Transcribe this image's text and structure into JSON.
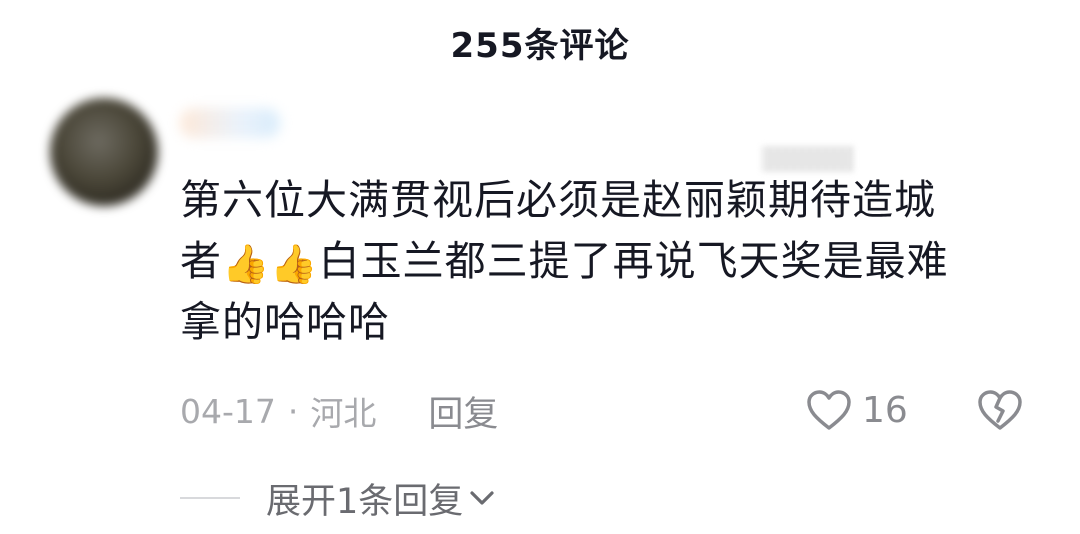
{
  "header": {
    "title": "255条评论"
  },
  "comment": {
    "text_line1": "第六位大满贯视后必须是赵丽颖期待造城",
    "text_line2_prefix": "者",
    "emoji": "👍",
    "text_line2_suffix": "白玉兰都三提了再说飞天奖是最难",
    "text_line3": "拿的哈哈哈",
    "date": "04-17",
    "separator": "·",
    "location": "河北",
    "reply_label": "回复",
    "like_count": "16",
    "expand_label": "展开1条回复"
  },
  "icons": {
    "like": "heart-outline-icon",
    "dislike": "broken-heart-icon",
    "expand": "chevron-down-icon"
  },
  "colors": {
    "text_primary": "#161823",
    "text_secondary": "#a8a9ad",
    "icon_gray": "#8a8b90"
  }
}
